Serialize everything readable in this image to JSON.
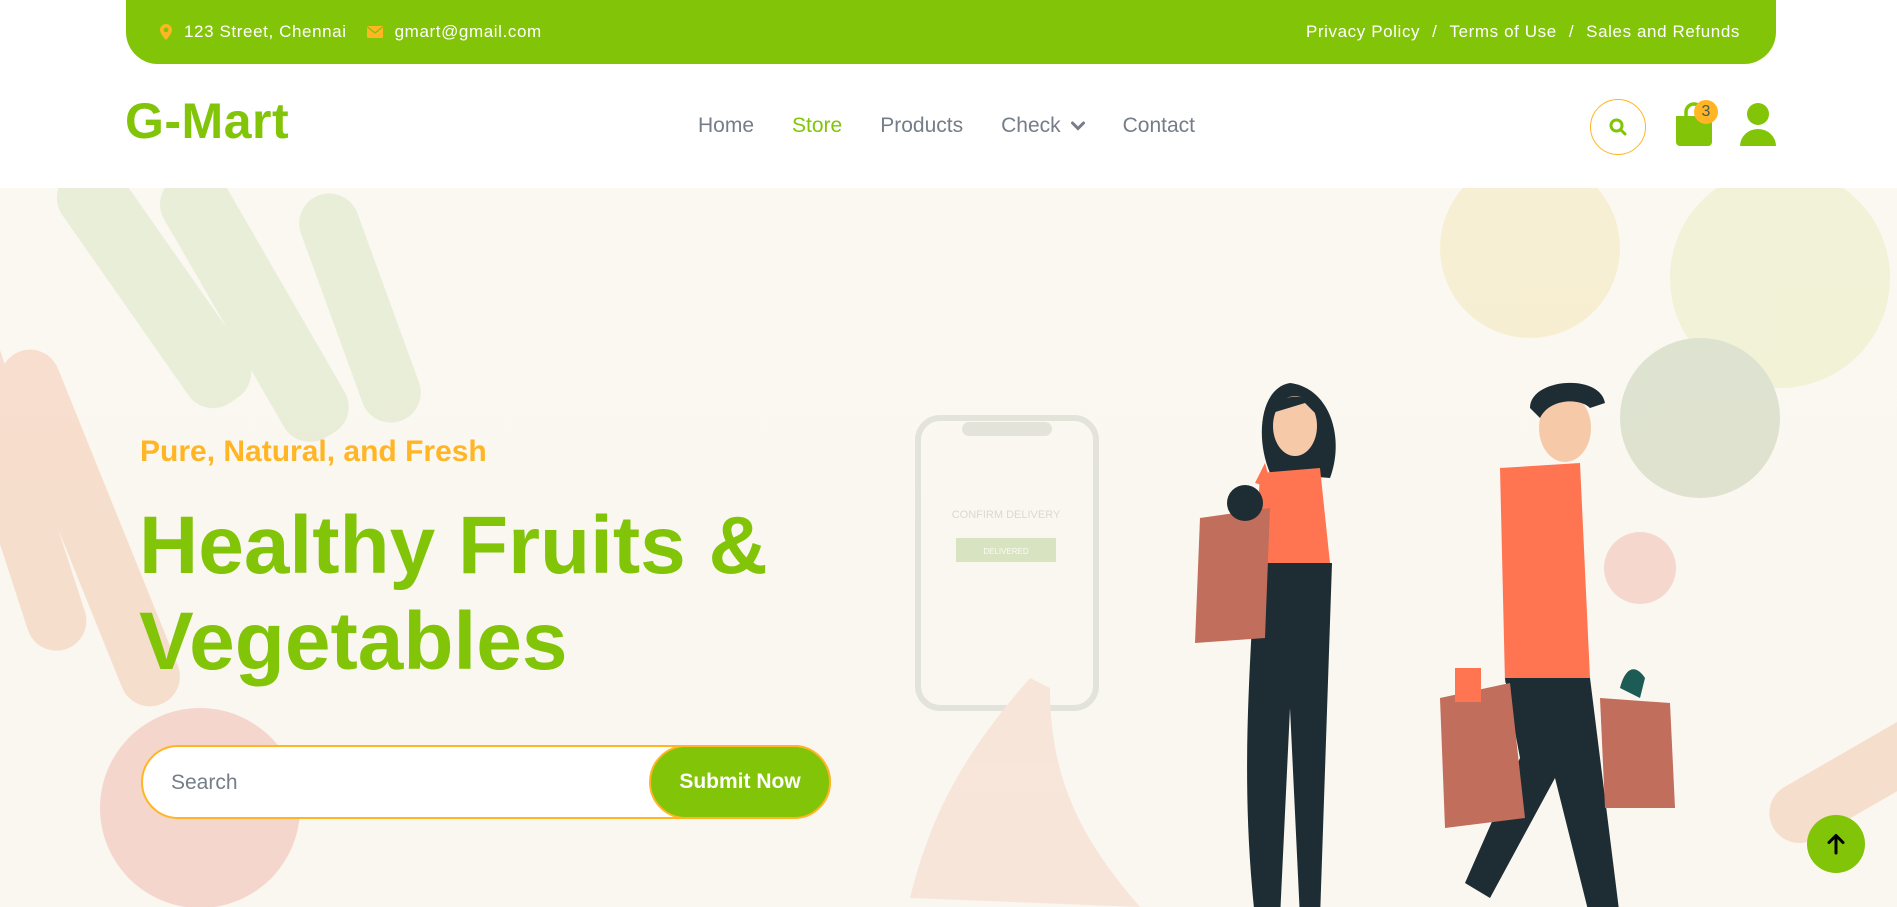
{
  "topbar": {
    "address": "123 Street, Chennai",
    "email": "gmart@gmail.com",
    "links": [
      "Privacy Policy",
      "Terms of Use",
      "Sales and Refunds"
    ],
    "separator": "/"
  },
  "nav": {
    "logo": "G-Mart",
    "items": [
      {
        "label": "Home",
        "active": false
      },
      {
        "label": "Store",
        "active": true
      },
      {
        "label": "Products",
        "active": false
      },
      {
        "label": "Check",
        "active": false,
        "dropdown": true
      },
      {
        "label": "Contact",
        "active": false
      }
    ],
    "cart_count": "3"
  },
  "hero": {
    "tagline": "Pure, Natural, and Fresh",
    "headline_line1": "Healthy Fruits &",
    "headline_line2": "Vegetables",
    "search_placeholder": "Search",
    "submit_label": "Submit Now",
    "phone_text": "CONFIRM DELIVERY",
    "phone_button": "DELIVERED"
  },
  "colors": {
    "primary": "#81c408",
    "secondary": "#ffb524",
    "text": "#747d88"
  },
  "icons": {
    "address": "map-marker-icon",
    "email": "envelope-icon",
    "search": "search-icon",
    "cart": "shopping-bag-icon",
    "user": "user-icon",
    "back_to_top": "arrow-up-icon"
  }
}
